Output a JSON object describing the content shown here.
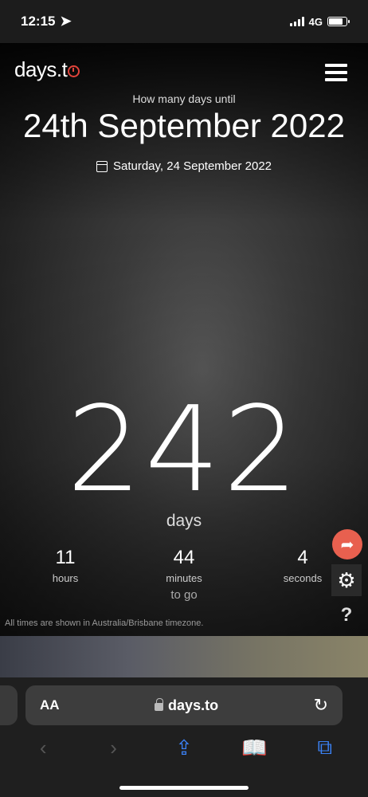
{
  "status_bar": {
    "time": "12:15",
    "network": "4G"
  },
  "site": {
    "logo_text": "days.t",
    "question": "How many days until",
    "target_title": "24th September 2022",
    "target_date": "Saturday, 24 September 2022"
  },
  "countdown": {
    "days": "242",
    "days_label": "days",
    "hours": "11",
    "hours_label": "hours",
    "minutes": "44",
    "minutes_label": "minutes",
    "seconds": "4",
    "seconds_label": "seconds",
    "to_go": "to go",
    "timezone_note": "All times are shown in Australia/Brisbane timezone."
  },
  "side_buttons": {
    "share_icon": "share-icon",
    "settings_icon": "gear-icon",
    "help_label": "?"
  },
  "browser": {
    "aa_label": "AA",
    "url": "days.to"
  },
  "colors": {
    "accent": "#e0433a",
    "share": "#e8604f",
    "safari_blue": "#3b82f6"
  }
}
